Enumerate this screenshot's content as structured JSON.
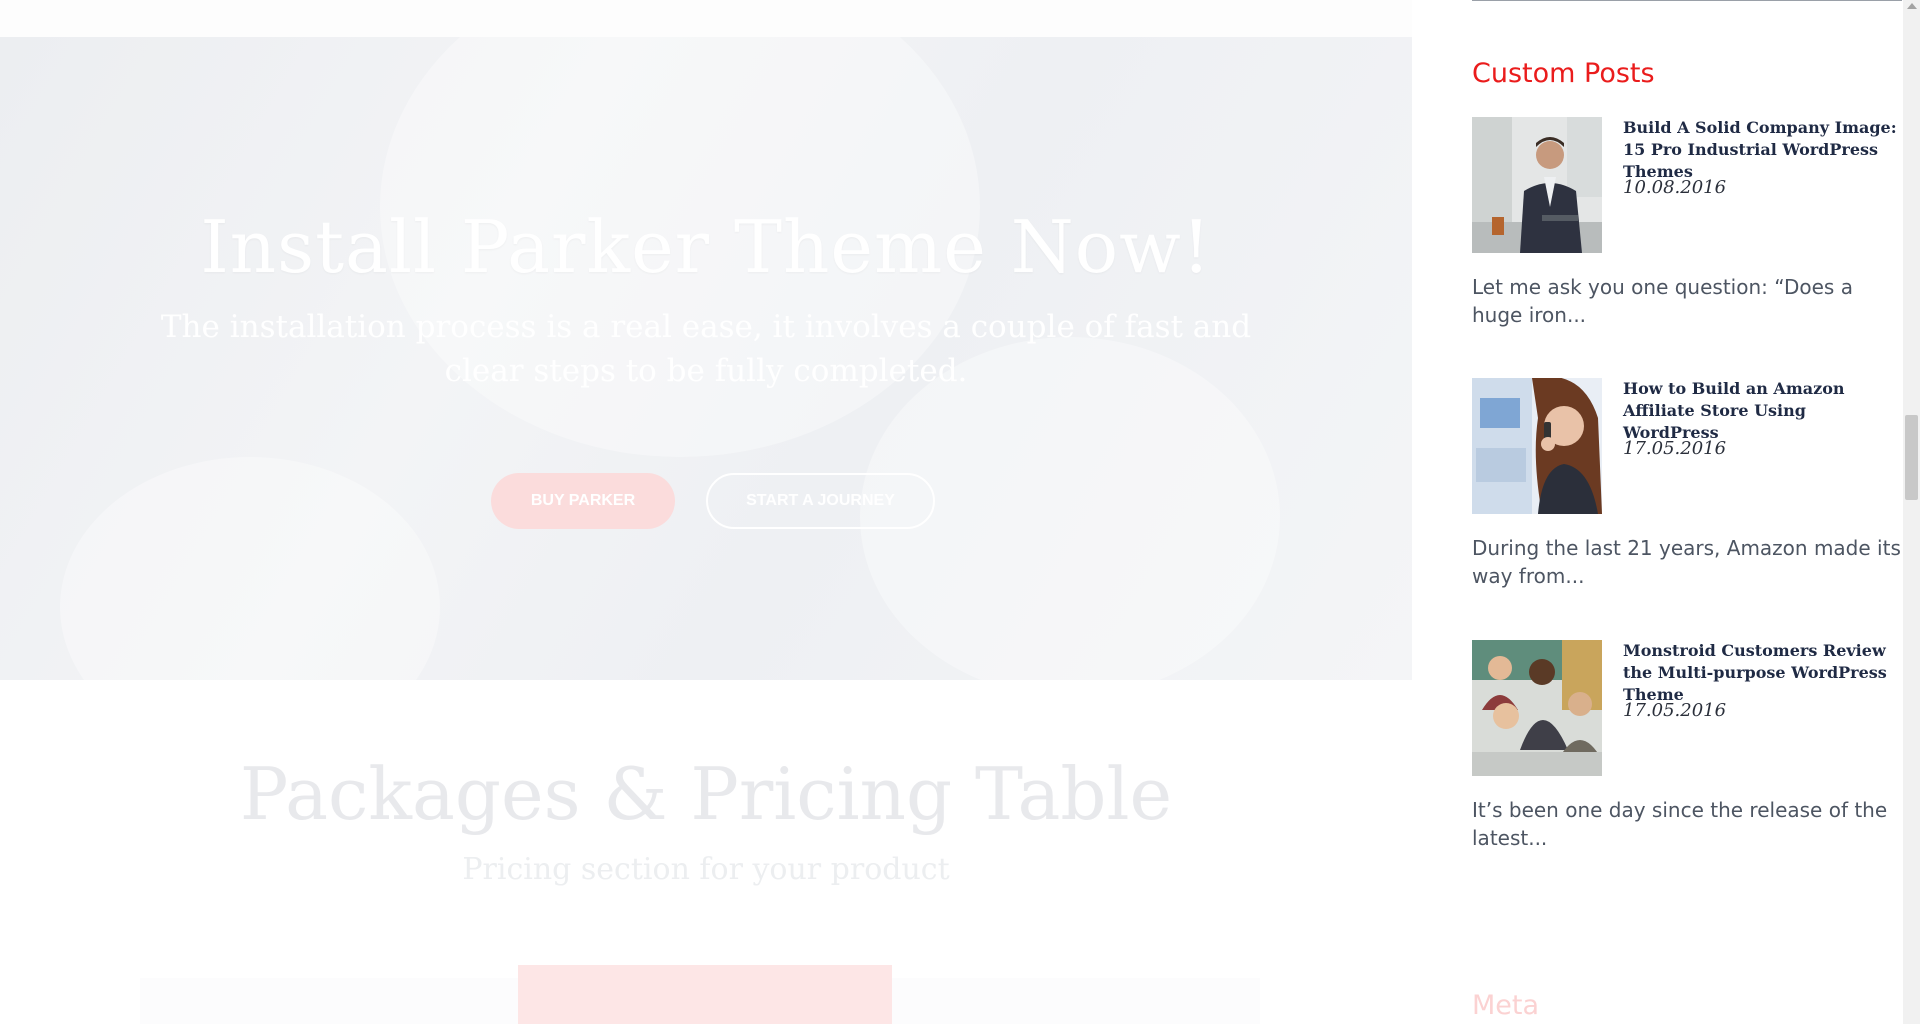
{
  "hero": {
    "title": "Install Parker Theme Now!",
    "subtitle": "The installation process is a real ease, it involves a couple of fast and clear steps to be fully completed.",
    "buy_label": "BUY PARKER",
    "journey_label": "START A JOURNEY"
  },
  "pricing": {
    "title": "Packages & Pricing Table",
    "subtitle": "Pricing section for your product"
  },
  "sidebar": {
    "custom_posts_title": "Custom Posts",
    "posts": [
      {
        "title": "Build A Solid Company Image: 15 Pro Industrial WordPress Themes",
        "date": "10.08.2016",
        "excerpt": "Let me ask you one question: “Does a huge iron...",
        "thumb_icon": "businessman-phone-photo"
      },
      {
        "title": "How to Build an Amazon Affiliate Store Using WordPress",
        "date": "17.05.2016",
        "excerpt": "During the last 21 years, Amazon made its way from...",
        "thumb_icon": "woman-on-phone-photo"
      },
      {
        "title": "Monstroid Customers Review the Multi-purpose WordPress Theme",
        "date": "17.05.2016",
        "excerpt": "It’s been one day since the release of the latest...",
        "thumb_icon": "team-meeting-photo"
      }
    ],
    "meta_title": "Meta"
  },
  "colors": {
    "accent": "#ea1c1c",
    "button_pink": "#fbdcdc",
    "hero_bg": "#eef0f3"
  }
}
